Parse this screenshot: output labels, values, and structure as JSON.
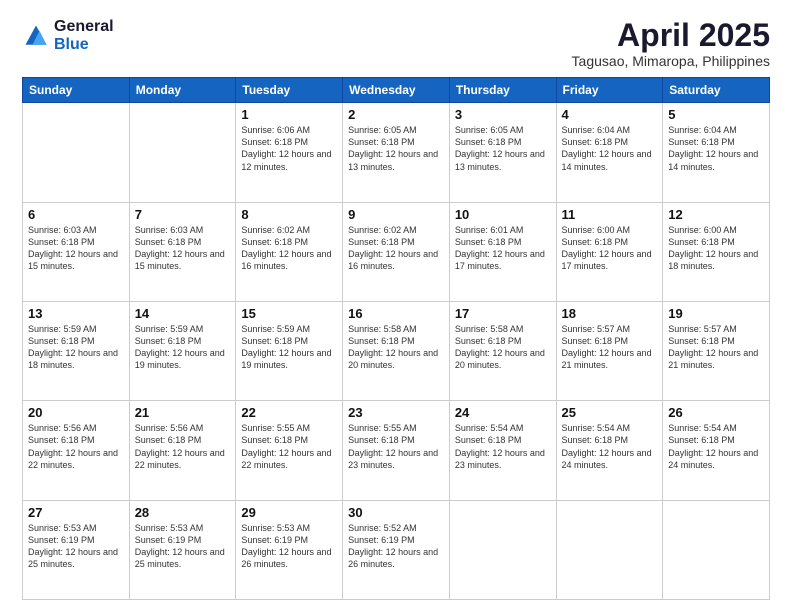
{
  "logo": {
    "general": "General",
    "blue": "Blue"
  },
  "title": "April 2025",
  "location": "Tagusao, Mimaropa, Philippines",
  "weekdays": [
    "Sunday",
    "Monday",
    "Tuesday",
    "Wednesday",
    "Thursday",
    "Friday",
    "Saturday"
  ],
  "weeks": [
    [
      {
        "day": "",
        "info": ""
      },
      {
        "day": "",
        "info": ""
      },
      {
        "day": "1",
        "info": "Sunrise: 6:06 AM\nSunset: 6:18 PM\nDaylight: 12 hours and 12 minutes."
      },
      {
        "day": "2",
        "info": "Sunrise: 6:05 AM\nSunset: 6:18 PM\nDaylight: 12 hours and 13 minutes."
      },
      {
        "day": "3",
        "info": "Sunrise: 6:05 AM\nSunset: 6:18 PM\nDaylight: 12 hours and 13 minutes."
      },
      {
        "day": "4",
        "info": "Sunrise: 6:04 AM\nSunset: 6:18 PM\nDaylight: 12 hours and 14 minutes."
      },
      {
        "day": "5",
        "info": "Sunrise: 6:04 AM\nSunset: 6:18 PM\nDaylight: 12 hours and 14 minutes."
      }
    ],
    [
      {
        "day": "6",
        "info": "Sunrise: 6:03 AM\nSunset: 6:18 PM\nDaylight: 12 hours and 15 minutes."
      },
      {
        "day": "7",
        "info": "Sunrise: 6:03 AM\nSunset: 6:18 PM\nDaylight: 12 hours and 15 minutes."
      },
      {
        "day": "8",
        "info": "Sunrise: 6:02 AM\nSunset: 6:18 PM\nDaylight: 12 hours and 16 minutes."
      },
      {
        "day": "9",
        "info": "Sunrise: 6:02 AM\nSunset: 6:18 PM\nDaylight: 12 hours and 16 minutes."
      },
      {
        "day": "10",
        "info": "Sunrise: 6:01 AM\nSunset: 6:18 PM\nDaylight: 12 hours and 17 minutes."
      },
      {
        "day": "11",
        "info": "Sunrise: 6:00 AM\nSunset: 6:18 PM\nDaylight: 12 hours and 17 minutes."
      },
      {
        "day": "12",
        "info": "Sunrise: 6:00 AM\nSunset: 6:18 PM\nDaylight: 12 hours and 18 minutes."
      }
    ],
    [
      {
        "day": "13",
        "info": "Sunrise: 5:59 AM\nSunset: 6:18 PM\nDaylight: 12 hours and 18 minutes."
      },
      {
        "day": "14",
        "info": "Sunrise: 5:59 AM\nSunset: 6:18 PM\nDaylight: 12 hours and 19 minutes."
      },
      {
        "day": "15",
        "info": "Sunrise: 5:59 AM\nSunset: 6:18 PM\nDaylight: 12 hours and 19 minutes."
      },
      {
        "day": "16",
        "info": "Sunrise: 5:58 AM\nSunset: 6:18 PM\nDaylight: 12 hours and 20 minutes."
      },
      {
        "day": "17",
        "info": "Sunrise: 5:58 AM\nSunset: 6:18 PM\nDaylight: 12 hours and 20 minutes."
      },
      {
        "day": "18",
        "info": "Sunrise: 5:57 AM\nSunset: 6:18 PM\nDaylight: 12 hours and 21 minutes."
      },
      {
        "day": "19",
        "info": "Sunrise: 5:57 AM\nSunset: 6:18 PM\nDaylight: 12 hours and 21 minutes."
      }
    ],
    [
      {
        "day": "20",
        "info": "Sunrise: 5:56 AM\nSunset: 6:18 PM\nDaylight: 12 hours and 22 minutes."
      },
      {
        "day": "21",
        "info": "Sunrise: 5:56 AM\nSunset: 6:18 PM\nDaylight: 12 hours and 22 minutes."
      },
      {
        "day": "22",
        "info": "Sunrise: 5:55 AM\nSunset: 6:18 PM\nDaylight: 12 hours and 22 minutes."
      },
      {
        "day": "23",
        "info": "Sunrise: 5:55 AM\nSunset: 6:18 PM\nDaylight: 12 hours and 23 minutes."
      },
      {
        "day": "24",
        "info": "Sunrise: 5:54 AM\nSunset: 6:18 PM\nDaylight: 12 hours and 23 minutes."
      },
      {
        "day": "25",
        "info": "Sunrise: 5:54 AM\nSunset: 6:18 PM\nDaylight: 12 hours and 24 minutes."
      },
      {
        "day": "26",
        "info": "Sunrise: 5:54 AM\nSunset: 6:18 PM\nDaylight: 12 hours and 24 minutes."
      }
    ],
    [
      {
        "day": "27",
        "info": "Sunrise: 5:53 AM\nSunset: 6:19 PM\nDaylight: 12 hours and 25 minutes."
      },
      {
        "day": "28",
        "info": "Sunrise: 5:53 AM\nSunset: 6:19 PM\nDaylight: 12 hours and 25 minutes."
      },
      {
        "day": "29",
        "info": "Sunrise: 5:53 AM\nSunset: 6:19 PM\nDaylight: 12 hours and 26 minutes."
      },
      {
        "day": "30",
        "info": "Sunrise: 5:52 AM\nSunset: 6:19 PM\nDaylight: 12 hours and 26 minutes."
      },
      {
        "day": "",
        "info": ""
      },
      {
        "day": "",
        "info": ""
      },
      {
        "day": "",
        "info": ""
      }
    ]
  ]
}
